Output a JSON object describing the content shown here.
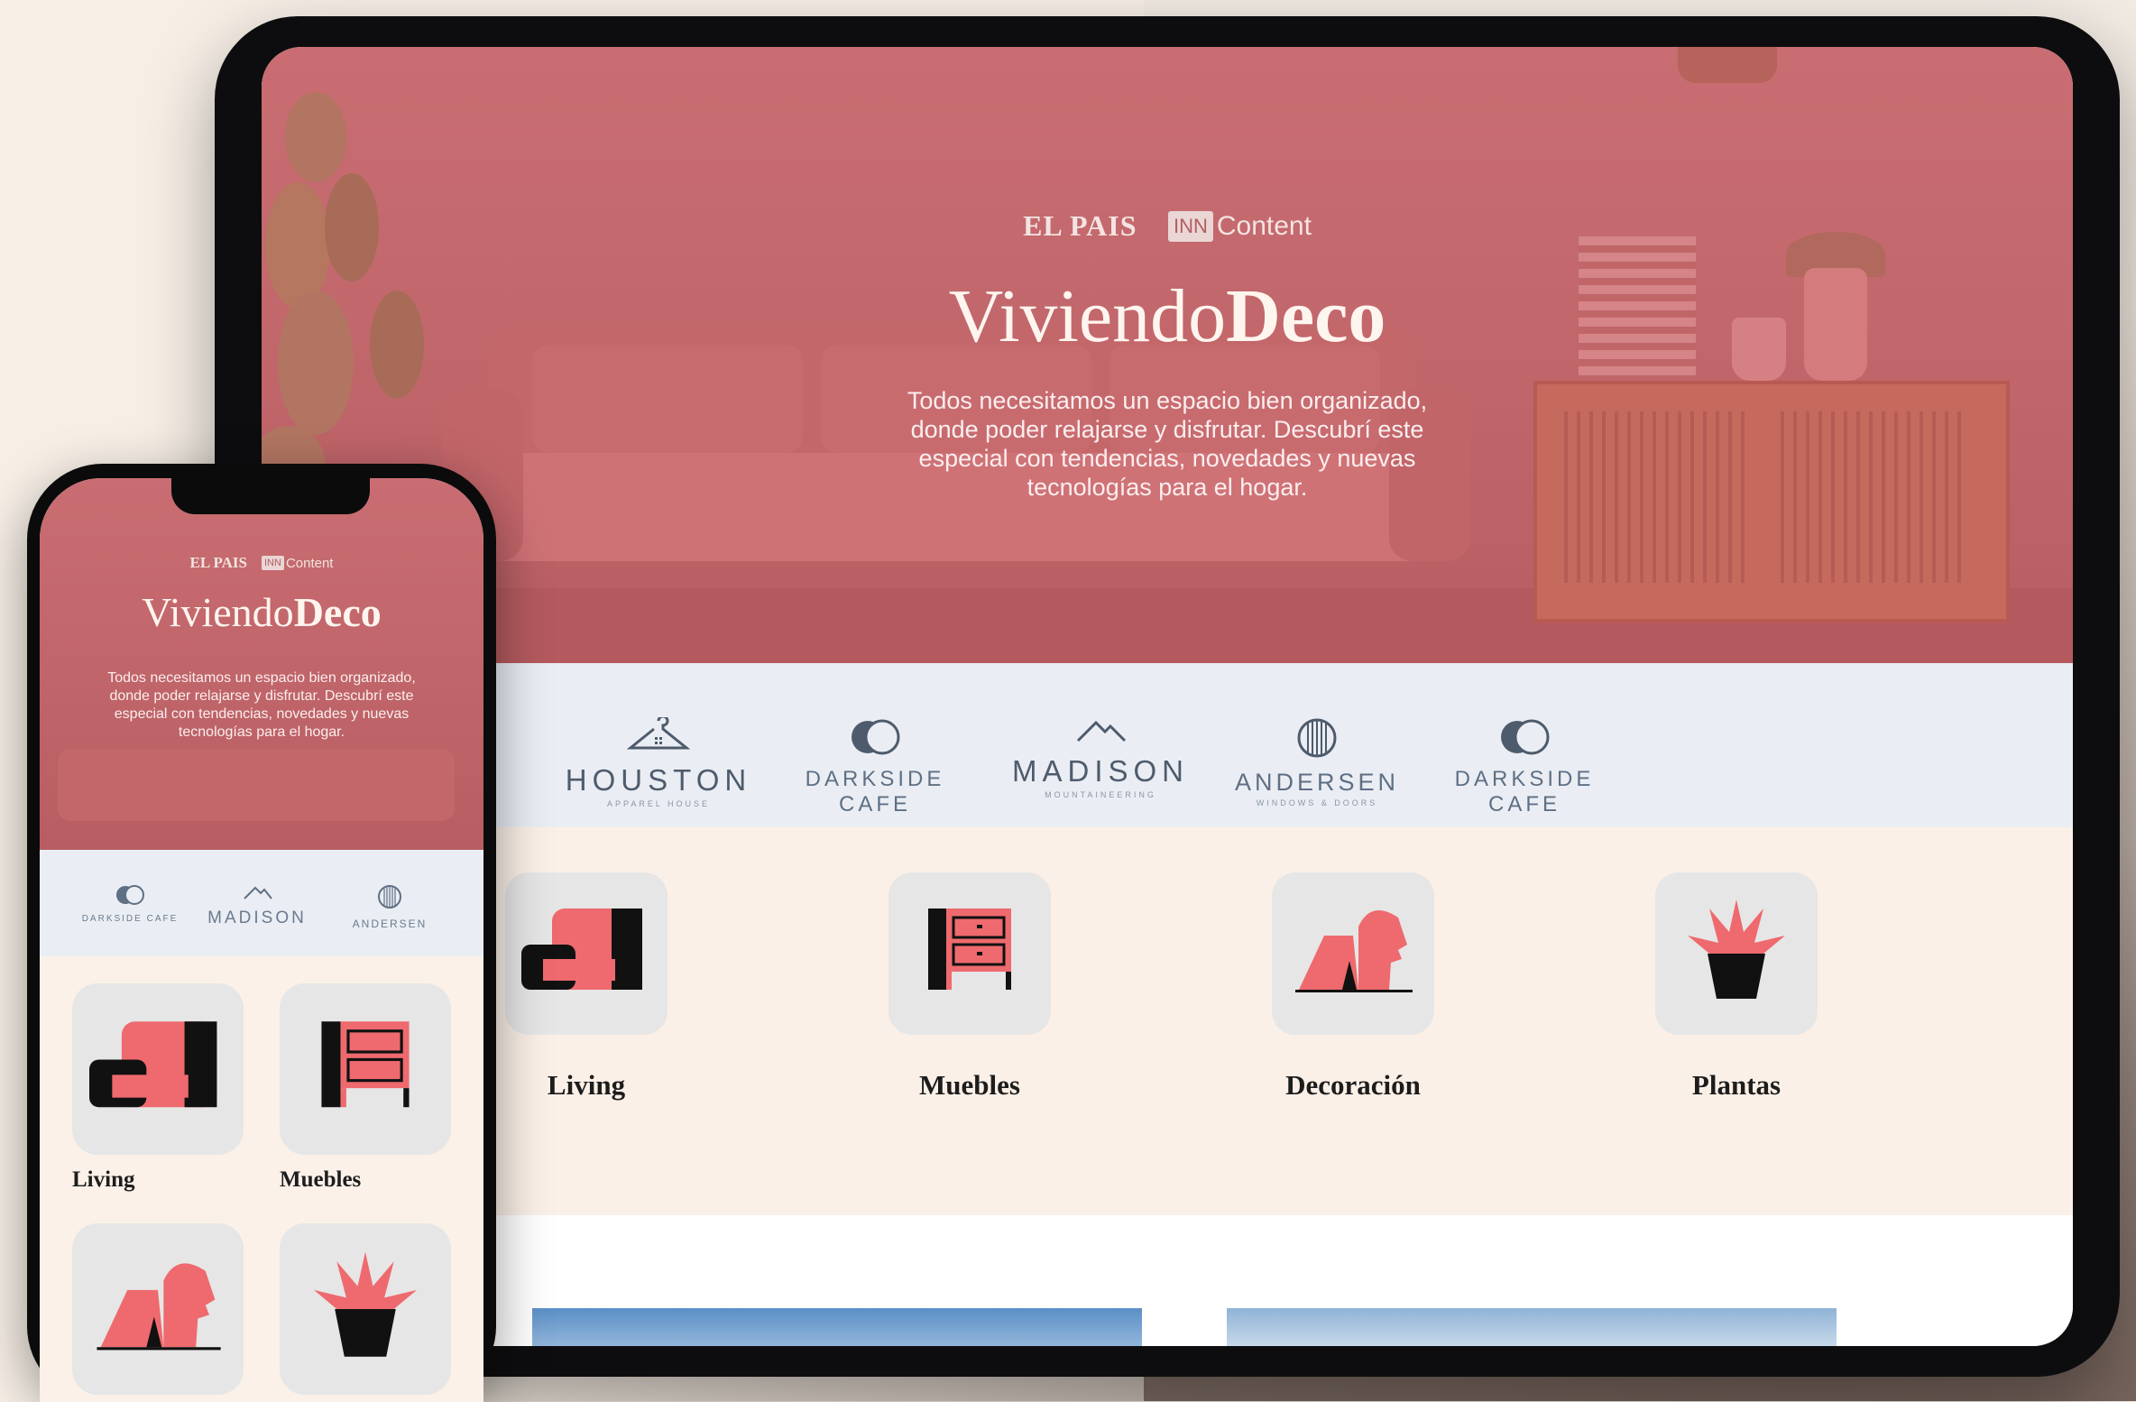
{
  "brand": {
    "publisher": "EL PAIS",
    "partner_badge": "INN",
    "partner_text": "Content",
    "title_light": "Viviendo",
    "title_bold": "Deco",
    "description_lines": [
      "Todos necesitamos un espacio bien organizado,",
      "donde poder relajarse y disfrutar. Descubrí este",
      "especial con tendencias, novedades y nuevas",
      "tecnologías para el hogar."
    ]
  },
  "logos": {
    "tablet": [
      {
        "name": "HOUSTON",
        "sub": "APPAREL HOUSE",
        "icon": "hanger-icon"
      },
      {
        "name": "DARKSIDE CAFE",
        "sub": "",
        "icon": "circles-icon"
      },
      {
        "name": "MADISON",
        "sub": "MOUNTAINEERING",
        "icon": "mountain-icon"
      },
      {
        "name": "ANDERSEN",
        "sub": "WINDOWS & DOORS",
        "icon": "globe-icon"
      },
      {
        "name": "DARKSIDE CAFE",
        "sub": "",
        "icon": "circles-icon"
      }
    ],
    "phone": [
      {
        "name": "DARKSIDE CAFE",
        "icon": "circles-icon"
      },
      {
        "name": "MADISON",
        "icon": "mountain-icon"
      },
      {
        "name": "ANDERSEN",
        "icon": "globe-icon"
      }
    ]
  },
  "categories": [
    {
      "label": "Living",
      "icon": "armchair-icon"
    },
    {
      "label": "Muebles",
      "icon": "dresser-icon"
    },
    {
      "label": "Decoración",
      "icon": "sculpture-icon"
    },
    {
      "label": "Plantas",
      "icon": "plant-icon"
    }
  ],
  "colors": {
    "hero": "#c0666a",
    "accent": "#ee6a6e",
    "logo_band": "#eaeef4",
    "cream": "#fbf0e7"
  }
}
